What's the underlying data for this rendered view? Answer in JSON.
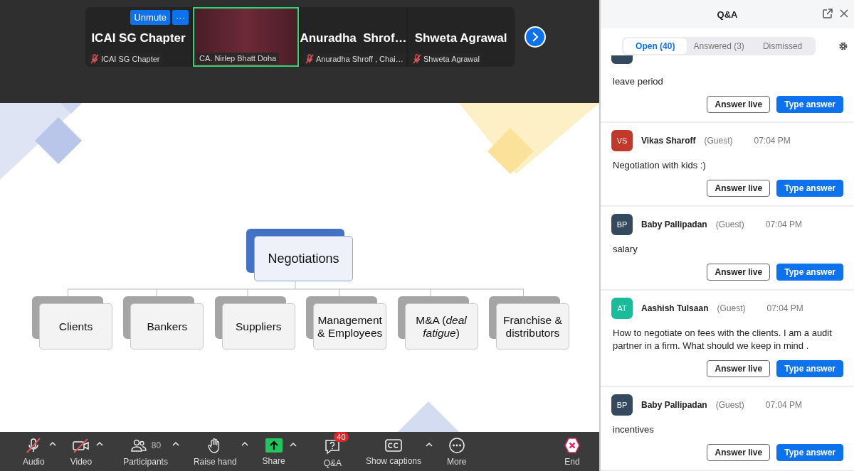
{
  "gallery": {
    "tiles": [
      {
        "kind": "name",
        "name": "ICAI SG Chapter",
        "label": "ICAI SG Chapter",
        "muted": true,
        "active_speaker": false,
        "hover_buttons": {
          "unmute": "Unmute",
          "more": "···"
        }
      },
      {
        "kind": "video",
        "label": "CA. Nirlep Bhatt Doha",
        "muted": false,
        "active_speaker": true
      },
      {
        "kind": "name",
        "name": "Anuradha  Shrof…",
        "label": "Anuradha Shroff , Chai…",
        "muted": true,
        "active_speaker": false
      },
      {
        "kind": "name",
        "name": "Shweta Agrawal",
        "label": "Shweta Agrawal",
        "muted": true,
        "active_speaker": false
      }
    ]
  },
  "slide": {
    "root": "Negotiations",
    "children": [
      "Clients",
      "Bankers",
      "Suppliers",
      "Management & Employees",
      "M&A (*deal fatigue*)",
      "Franchise & distributors"
    ]
  },
  "toolbar": [
    {
      "kind": "audio",
      "label": "Audio",
      "caret": true,
      "off": true
    },
    {
      "kind": "video",
      "label": "Video",
      "caret": true,
      "off": true
    },
    {
      "kind": "participants",
      "label": "Participants",
      "count": "80",
      "caret": true
    },
    {
      "kind": "hand",
      "label": "Raise hand",
      "caret": true
    },
    {
      "kind": "share",
      "label": "Share",
      "caret": true
    },
    {
      "kind": "qa",
      "label": "Q&A",
      "badge": "40",
      "caret": false
    },
    {
      "kind": "captions",
      "label": "Show captions",
      "caret": true
    },
    {
      "kind": "more",
      "label": "More",
      "caret": false
    },
    {
      "kind": "end",
      "label": "End",
      "caret": false
    }
  ],
  "qa": {
    "title": "Q&A",
    "tabs": [
      {
        "label": "Open (40)",
        "selected": true
      },
      {
        "label": "Answered (3)",
        "selected": false
      },
      {
        "label": "Dismissed",
        "selected": false
      }
    ],
    "questions": [
      {
        "color": "#34495e",
        "text": "leave period",
        "answer_live": "Answer live",
        "type_answer": "Type answer"
      },
      {
        "initials": "VS",
        "name": "Vikas Sharoff",
        "role": "(Guest)",
        "time": "07:04 PM",
        "color": "#c0392b",
        "text": "Negotiation with kids :)",
        "answer_live": "Answer live",
        "type_answer": "Type answer"
      },
      {
        "initials": "BP",
        "name": "Baby Pallipadan",
        "role": "(Guest)",
        "time": "07:04 PM",
        "color": "#34495e",
        "text": "salary",
        "answer_live": "Answer live",
        "type_answer": "Type answer"
      },
      {
        "initials": "AT",
        "name": "Aashish Tulsaan",
        "role": "(Guest)",
        "time": "07:04 PM",
        "color": "#1abc9c",
        "text": "How to negotiate on fees with the clients. I am a audit partner in a firm. What should we keep in mind .",
        "answer_live": "Answer live",
        "type_answer": "Type answer"
      },
      {
        "initials": "BP",
        "name": "Baby Pallipadan",
        "role": "(Guest)",
        "time": "07:04 PM",
        "color": "#34495e",
        "text": "incentives",
        "answer_live": "Answer live",
        "type_answer": "Type answer"
      }
    ]
  }
}
